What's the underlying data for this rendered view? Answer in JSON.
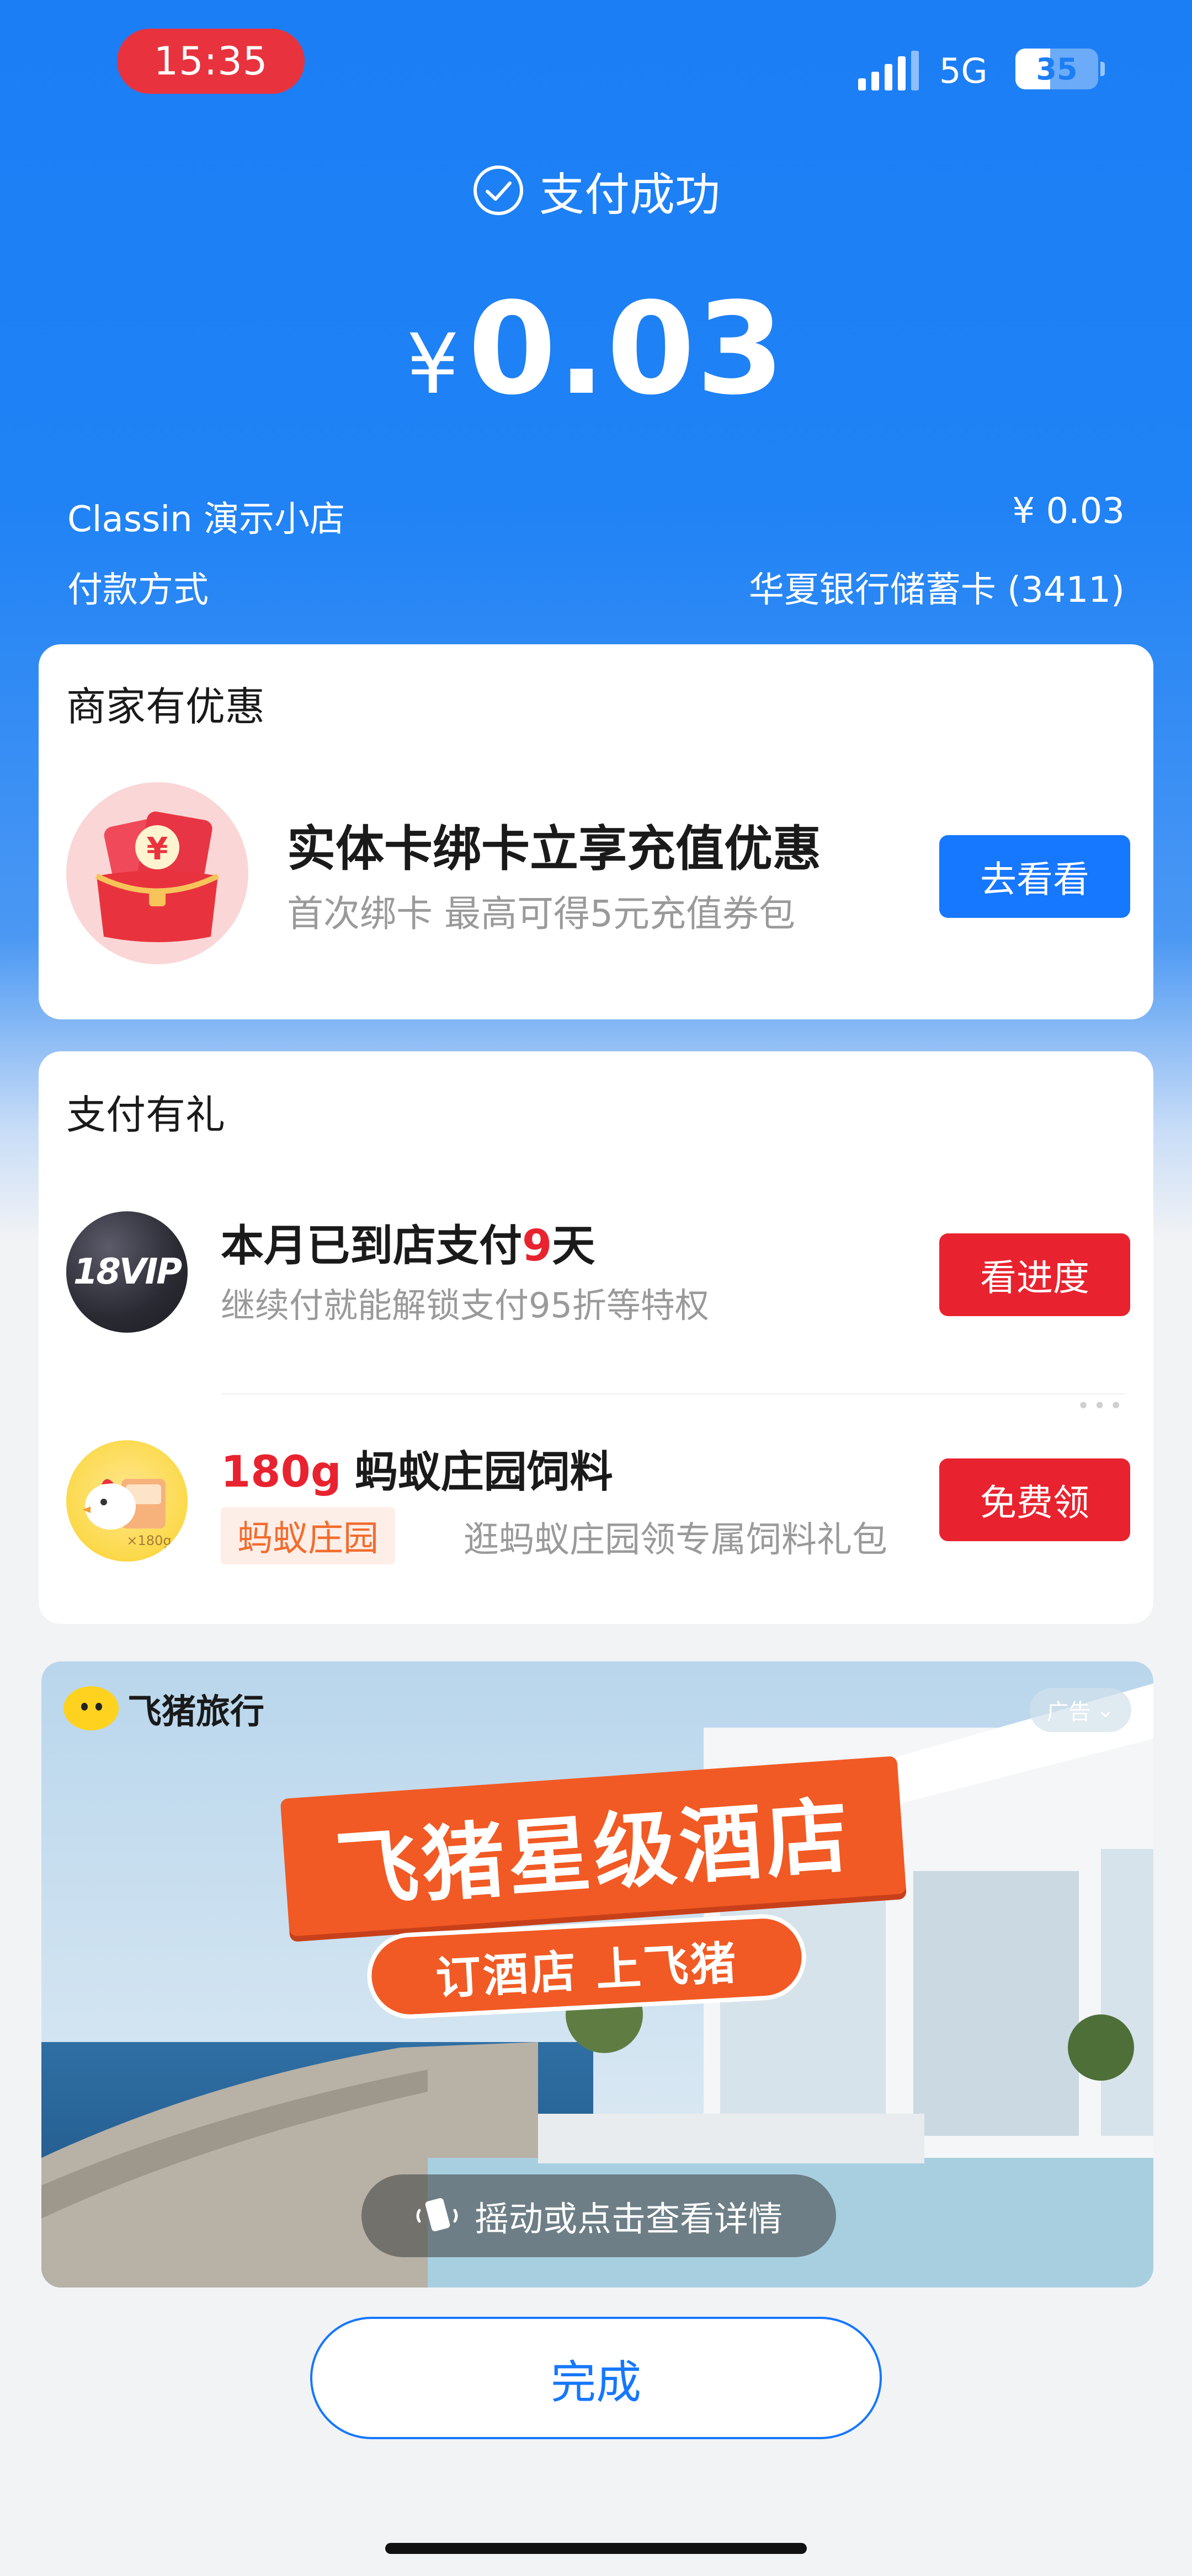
{
  "status_bar": {
    "time": "15:35",
    "network": "5G",
    "battery": "35"
  },
  "header": {
    "status": "支付成功",
    "currency": "¥",
    "amount": "0.03"
  },
  "order": {
    "merchant": "Classin 演示小店",
    "merchant_amount": "¥ 0.03",
    "method_label": "付款方式",
    "method_value": "华夏银行储蓄卡 (3411)"
  },
  "merchant_offer": {
    "section_title": "商家有优惠",
    "title": "实体卡绑卡立享充值优惠",
    "subtitle": "首次绑卡 最高可得5元充值券包",
    "button": "去看看"
  },
  "pay_gift": {
    "section_title": "支付有礼",
    "vip": {
      "icon_text": "18VIP",
      "title_prefix": "本月已到店支付",
      "title_days": "9",
      "title_suffix": "天",
      "subtitle": "继续付就能解锁支付95折等特权",
      "button": "看进度"
    },
    "feed": {
      "icon_badge": "×180g",
      "amount": "180g",
      "title": "蚂蚁庄园饲料",
      "tag": "蚂蚁庄园",
      "subtitle": "逛蚂蚁庄园领专属饲料礼包",
      "button": "免费领"
    }
  },
  "ad": {
    "brand": "飞猪旅行",
    "tag": "广告",
    "headline": "飞猪星级酒店",
    "slogan": "订酒店 上飞猪",
    "hint": "摇动或点击查看详情"
  },
  "done_button": "完成",
  "colors": {
    "primary": "#1677ff",
    "red": "#e8232f",
    "header_blue": "#1c7ef5"
  }
}
